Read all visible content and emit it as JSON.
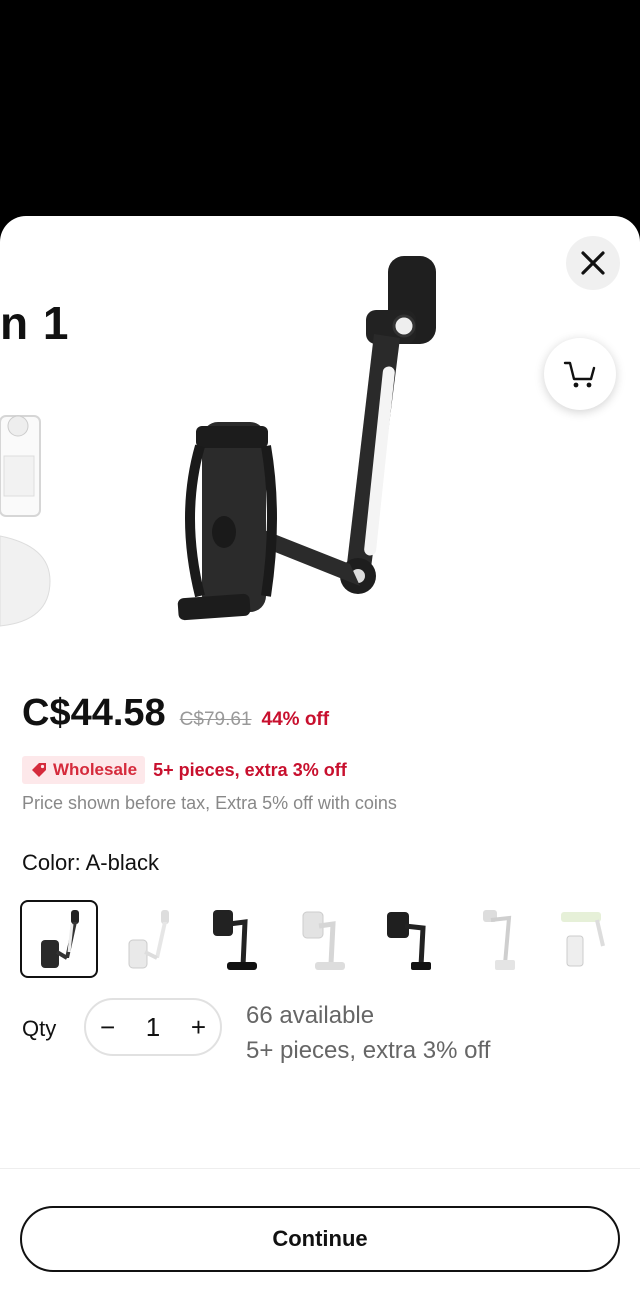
{
  "gallery": {
    "prev_title_fragment": "n 1"
  },
  "price": {
    "current": "C$44.58",
    "original": "C$79.61",
    "discount": "44% off"
  },
  "promo": {
    "tag_label": "Wholesale",
    "text": "5+ pieces, extra 3% off"
  },
  "tax_note": "Price shown before tax, Extra 5% off with coins",
  "color": {
    "label": "Color: A-black",
    "swatch_count": 7,
    "selected_index": 0
  },
  "quantity": {
    "label": "Qty",
    "value": "1",
    "minus": "−",
    "plus": "+",
    "available": "66 available",
    "bulk_note": "5+ pieces, extra 3% off"
  },
  "continue_label": "Continue",
  "icons": {
    "close": "close-icon",
    "cart": "cart-icon",
    "tag": "tag-icon"
  },
  "colors": {
    "accent_red": "#c8102e",
    "tag_bg": "#fde8ea"
  }
}
